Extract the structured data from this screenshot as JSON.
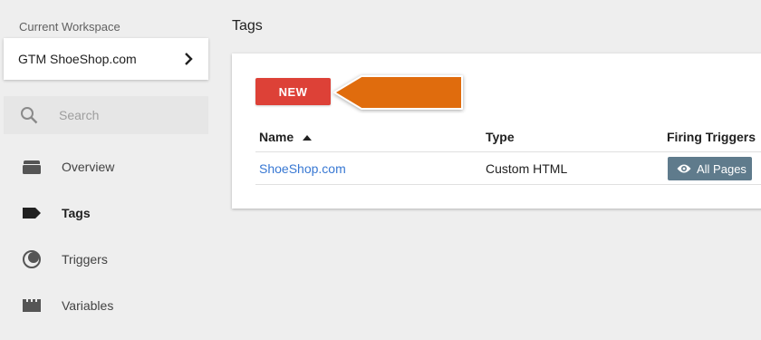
{
  "sidebar": {
    "workspace_caption": "Current Workspace",
    "workspace_name": "GTM ShoeShop.com",
    "search_placeholder": "Search",
    "items": [
      {
        "label": "Overview",
        "icon": "folder-icon"
      },
      {
        "label": "Tags",
        "icon": "tag-icon",
        "active": true
      },
      {
        "label": "Triggers",
        "icon": "trigger-icon"
      },
      {
        "label": "Variables",
        "icon": "variables-icon"
      }
    ]
  },
  "main": {
    "title": "Tags",
    "new_button_label": "NEW",
    "table": {
      "headers": [
        "Name",
        "Type",
        "Firing Triggers"
      ],
      "sort_column": "Name",
      "rows": [
        {
          "name": "ShoeShop.com",
          "type": "Custom HTML",
          "trigger": "All Pages"
        }
      ]
    }
  },
  "colors": {
    "new_button": "#dd4137",
    "annotation_arrow": "#e06c0d",
    "link": "#3878d3",
    "trigger_chip": "#5f7b8c"
  }
}
